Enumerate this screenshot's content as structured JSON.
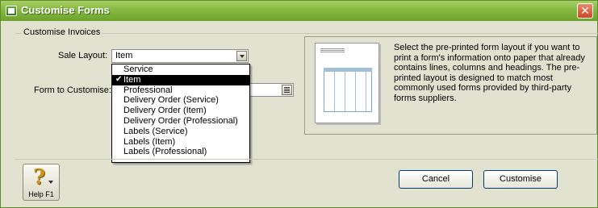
{
  "window": {
    "title": "Customise Forms",
    "close_glyph": "✕"
  },
  "group": {
    "label": "Customise Invoices"
  },
  "sale_layout": {
    "label": "Sale Layout:",
    "value": "Item"
  },
  "form_to_customise": {
    "label": "Form to Customise:",
    "value": ""
  },
  "dropdown": {
    "items": [
      {
        "label": "Service",
        "selected": false
      },
      {
        "label": "Item",
        "selected": true
      },
      {
        "label": "Professional",
        "selected": false
      },
      {
        "label": "Delivery Order (Service)",
        "selected": false
      },
      {
        "label": "Delivery Order (Item)",
        "selected": false
      },
      {
        "label": "Delivery Order (Professional)",
        "selected": false
      },
      {
        "label": "Labels (Service)",
        "selected": false
      },
      {
        "label": "Labels (Item)",
        "selected": false
      },
      {
        "label": "Labels (Professional)",
        "selected": false
      }
    ],
    "check_glyph": "✔"
  },
  "description": "Select the pre-printed form layout if you want to print a form's information onto paper that already contains lines, columns and headings. The pre-printed layout is designed to match most commonly used forms provided by third-party forms suppliers.",
  "buttons": {
    "help_label": "Help F1",
    "help_glyph": "?",
    "cancel_label": "Cancel",
    "customise_label": "Customise"
  },
  "icons": {
    "app": "app-icon",
    "close": "close-icon",
    "help": "help-icon",
    "combo_arrow": "chevron-down-icon",
    "list_arrow": "list-icon",
    "check": "check-icon"
  }
}
